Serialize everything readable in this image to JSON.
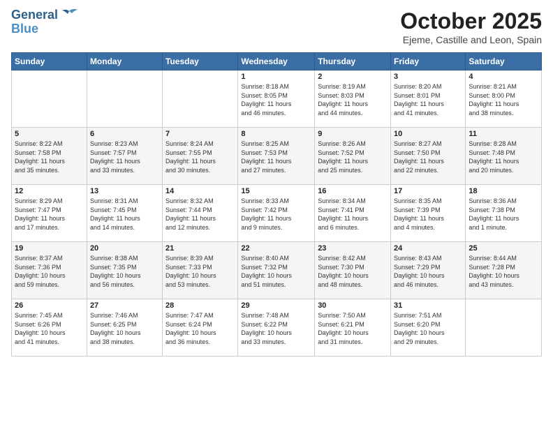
{
  "logo": {
    "line1": "General",
    "line2": "Blue"
  },
  "title": "October 2025",
  "subtitle": "Ejeme, Castille and Leon, Spain",
  "weekdays": [
    "Sunday",
    "Monday",
    "Tuesday",
    "Wednesday",
    "Thursday",
    "Friday",
    "Saturday"
  ],
  "weeks": [
    [
      {
        "day": "",
        "info": ""
      },
      {
        "day": "",
        "info": ""
      },
      {
        "day": "",
        "info": ""
      },
      {
        "day": "1",
        "info": "Sunrise: 8:18 AM\nSunset: 8:05 PM\nDaylight: 11 hours\nand 46 minutes."
      },
      {
        "day": "2",
        "info": "Sunrise: 8:19 AM\nSunset: 8:03 PM\nDaylight: 11 hours\nand 44 minutes."
      },
      {
        "day": "3",
        "info": "Sunrise: 8:20 AM\nSunset: 8:01 PM\nDaylight: 11 hours\nand 41 minutes."
      },
      {
        "day": "4",
        "info": "Sunrise: 8:21 AM\nSunset: 8:00 PM\nDaylight: 11 hours\nand 38 minutes."
      }
    ],
    [
      {
        "day": "5",
        "info": "Sunrise: 8:22 AM\nSunset: 7:58 PM\nDaylight: 11 hours\nand 35 minutes."
      },
      {
        "day": "6",
        "info": "Sunrise: 8:23 AM\nSunset: 7:57 PM\nDaylight: 11 hours\nand 33 minutes."
      },
      {
        "day": "7",
        "info": "Sunrise: 8:24 AM\nSunset: 7:55 PM\nDaylight: 11 hours\nand 30 minutes."
      },
      {
        "day": "8",
        "info": "Sunrise: 8:25 AM\nSunset: 7:53 PM\nDaylight: 11 hours\nand 27 minutes."
      },
      {
        "day": "9",
        "info": "Sunrise: 8:26 AM\nSunset: 7:52 PM\nDaylight: 11 hours\nand 25 minutes."
      },
      {
        "day": "10",
        "info": "Sunrise: 8:27 AM\nSunset: 7:50 PM\nDaylight: 11 hours\nand 22 minutes."
      },
      {
        "day": "11",
        "info": "Sunrise: 8:28 AM\nSunset: 7:48 PM\nDaylight: 11 hours\nand 20 minutes."
      }
    ],
    [
      {
        "day": "12",
        "info": "Sunrise: 8:29 AM\nSunset: 7:47 PM\nDaylight: 11 hours\nand 17 minutes."
      },
      {
        "day": "13",
        "info": "Sunrise: 8:31 AM\nSunset: 7:45 PM\nDaylight: 11 hours\nand 14 minutes."
      },
      {
        "day": "14",
        "info": "Sunrise: 8:32 AM\nSunset: 7:44 PM\nDaylight: 11 hours\nand 12 minutes."
      },
      {
        "day": "15",
        "info": "Sunrise: 8:33 AM\nSunset: 7:42 PM\nDaylight: 11 hours\nand 9 minutes."
      },
      {
        "day": "16",
        "info": "Sunrise: 8:34 AM\nSunset: 7:41 PM\nDaylight: 11 hours\nand 6 minutes."
      },
      {
        "day": "17",
        "info": "Sunrise: 8:35 AM\nSunset: 7:39 PM\nDaylight: 11 hours\nand 4 minutes."
      },
      {
        "day": "18",
        "info": "Sunrise: 8:36 AM\nSunset: 7:38 PM\nDaylight: 11 hours\nand 1 minute."
      }
    ],
    [
      {
        "day": "19",
        "info": "Sunrise: 8:37 AM\nSunset: 7:36 PM\nDaylight: 10 hours\nand 59 minutes."
      },
      {
        "day": "20",
        "info": "Sunrise: 8:38 AM\nSunset: 7:35 PM\nDaylight: 10 hours\nand 56 minutes."
      },
      {
        "day": "21",
        "info": "Sunrise: 8:39 AM\nSunset: 7:33 PM\nDaylight: 10 hours\nand 53 minutes."
      },
      {
        "day": "22",
        "info": "Sunrise: 8:40 AM\nSunset: 7:32 PM\nDaylight: 10 hours\nand 51 minutes."
      },
      {
        "day": "23",
        "info": "Sunrise: 8:42 AM\nSunset: 7:30 PM\nDaylight: 10 hours\nand 48 minutes."
      },
      {
        "day": "24",
        "info": "Sunrise: 8:43 AM\nSunset: 7:29 PM\nDaylight: 10 hours\nand 46 minutes."
      },
      {
        "day": "25",
        "info": "Sunrise: 8:44 AM\nSunset: 7:28 PM\nDaylight: 10 hours\nand 43 minutes."
      }
    ],
    [
      {
        "day": "26",
        "info": "Sunrise: 7:45 AM\nSunset: 6:26 PM\nDaylight: 10 hours\nand 41 minutes."
      },
      {
        "day": "27",
        "info": "Sunrise: 7:46 AM\nSunset: 6:25 PM\nDaylight: 10 hours\nand 38 minutes."
      },
      {
        "day": "28",
        "info": "Sunrise: 7:47 AM\nSunset: 6:24 PM\nDaylight: 10 hours\nand 36 minutes."
      },
      {
        "day": "29",
        "info": "Sunrise: 7:48 AM\nSunset: 6:22 PM\nDaylight: 10 hours\nand 33 minutes."
      },
      {
        "day": "30",
        "info": "Sunrise: 7:50 AM\nSunset: 6:21 PM\nDaylight: 10 hours\nand 31 minutes."
      },
      {
        "day": "31",
        "info": "Sunrise: 7:51 AM\nSunset: 6:20 PM\nDaylight: 10 hours\nand 29 minutes."
      },
      {
        "day": "",
        "info": ""
      }
    ]
  ]
}
